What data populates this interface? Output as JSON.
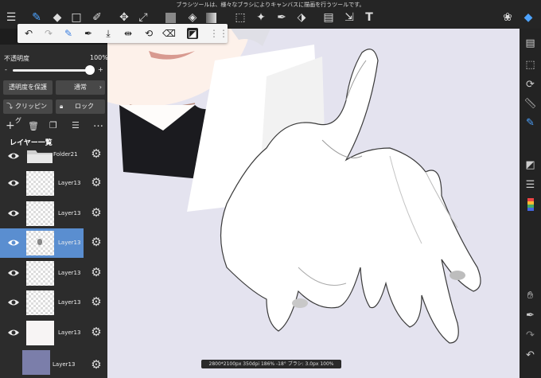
{
  "topbar": {
    "hint": "ブラシツールは、様々なブラシによりキャンバスに描画を行うツールです。",
    "icons": [
      "menu-icon",
      "brush-icon",
      "eraser-icon",
      "rect-select-icon",
      "pen-brush-icon",
      "move-icon",
      "transform-icon",
      "fill-color-icon",
      "bucket-icon",
      "gradient-icon",
      "select-icon",
      "magic-wand-icon",
      "eyedropper-select-icon",
      "select-pen-icon",
      "frame-icon",
      "layer-move-icon",
      "text-icon",
      "materials-icon",
      "layers-icon"
    ]
  },
  "subtoolbar": {
    "icons": [
      "undo-icon",
      "redo-icon",
      "pen-select-icon",
      "eyedropper-icon",
      "download-icon",
      "flip-icon",
      "rotate-off-icon",
      "eraser-box-icon",
      "invert-icon",
      "grid-icon"
    ]
  },
  "panel": {
    "opacity_label": "不透明度",
    "opacity_value": "100%",
    "opacity_level": 1.0,
    "slider_minus": "-",
    "slider_plus": "+",
    "protect_alpha": "透明度を保護",
    "blend_mode": "通常",
    "clipping": "クリッピング",
    "lock": "ロック",
    "layer_list_title": "レイヤー一覧",
    "layers": [
      {
        "name": "Folder21",
        "type": "folder",
        "selected": false
      },
      {
        "name": "Layer13",
        "type": "layer",
        "selected": false
      },
      {
        "name": "Layer13",
        "type": "layer",
        "selected": false
      },
      {
        "name": "Layer13",
        "type": "layer",
        "selected": true
      },
      {
        "name": "Layer13",
        "type": "layer",
        "selected": false
      },
      {
        "name": "Layer13",
        "type": "layer",
        "selected": false
      },
      {
        "name": "Layer13",
        "type": "layer",
        "selected": false
      },
      {
        "name": "Layer13",
        "type": "fill",
        "selected": false
      }
    ]
  },
  "status": {
    "text": "2800*2100px 350dpi 186% -18° ブラシ: 3.0px 100%"
  },
  "colors": {
    "selected_layer": "#5a8ed0",
    "canvas_bg": "#e4e3ef",
    "fill_layer": "#7b7eaa"
  }
}
